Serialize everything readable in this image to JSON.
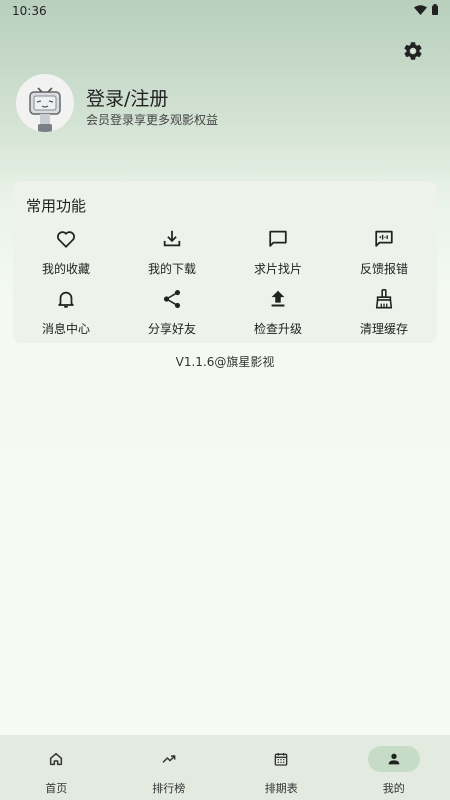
{
  "status_bar": {
    "time": "10:36"
  },
  "profile": {
    "title": "登录/注册",
    "subtitle": "会员登录享更多观影权益"
  },
  "functions": {
    "title": "常用功能",
    "items": [
      {
        "label": "我的收藏",
        "icon": "heart-icon"
      },
      {
        "label": "我的下载",
        "icon": "download-icon"
      },
      {
        "label": "求片找片",
        "icon": "chat-icon"
      },
      {
        "label": "反馈报错",
        "icon": "feedback-icon"
      },
      {
        "label": "消息中心",
        "icon": "bell-icon"
      },
      {
        "label": "分享好友",
        "icon": "share-icon"
      },
      {
        "label": "检查升级",
        "icon": "upload-icon"
      },
      {
        "label": "清理缓存",
        "icon": "broom-icon"
      }
    ]
  },
  "version": "V1.1.6@旗星影视",
  "bottom_nav": {
    "items": [
      {
        "label": "首页",
        "icon": "home-icon"
      },
      {
        "label": "排行榜",
        "icon": "trending-icon"
      },
      {
        "label": "排期表",
        "icon": "calendar-icon"
      },
      {
        "label": "我的",
        "icon": "person-icon",
        "active": true
      }
    ]
  }
}
